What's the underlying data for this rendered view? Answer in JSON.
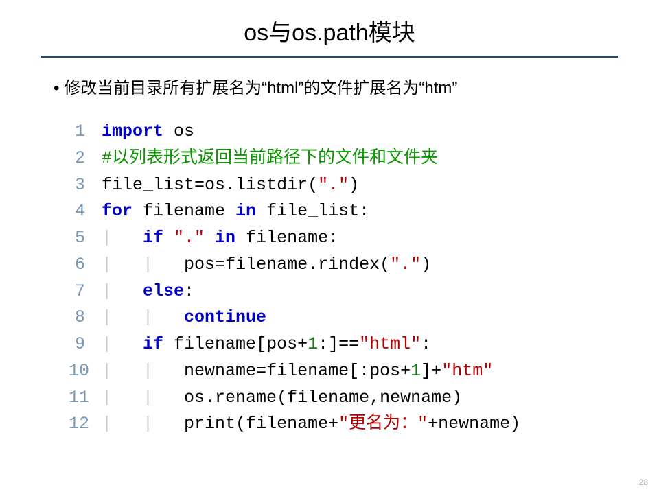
{
  "title": "os与os.path模块",
  "bullet": "修改当前目录所有扩展名为“html”的文件扩展名为“htm”",
  "page_number": "28",
  "code": {
    "lines": [
      {
        "n": "1",
        "tokens": [
          {
            "t": "import ",
            "c": "kw"
          },
          {
            "t": "os",
            "c": "id"
          }
        ]
      },
      {
        "n": "2",
        "tokens": [
          {
            "t": "#以列表形式返回当前路径下的文件和文件夹",
            "c": "cmt"
          }
        ]
      },
      {
        "n": "3",
        "tokens": [
          {
            "t": "file_list",
            "c": "id"
          },
          {
            "t": "=",
            "c": "punct"
          },
          {
            "t": "os.listdir",
            "c": "id"
          },
          {
            "t": "(",
            "c": "punct"
          },
          {
            "t": "\".\"",
            "c": "str"
          },
          {
            "t": ")",
            "c": "punct"
          }
        ]
      },
      {
        "n": "4",
        "tokens": [
          {
            "t": "for ",
            "c": "kw"
          },
          {
            "t": "filename ",
            "c": "id"
          },
          {
            "t": "in ",
            "c": "kw"
          },
          {
            "t": "file_list",
            "c": "id"
          },
          {
            "t": ":",
            "c": "punct"
          }
        ]
      },
      {
        "n": "5",
        "tokens": [
          {
            "t": "|   ",
            "c": "guide"
          },
          {
            "t": "if ",
            "c": "kw"
          },
          {
            "t": "\".\"",
            "c": "str"
          },
          {
            "t": " in ",
            "c": "kw"
          },
          {
            "t": "filename",
            "c": "id"
          },
          {
            "t": ":",
            "c": "punct"
          }
        ]
      },
      {
        "n": "6",
        "tokens": [
          {
            "t": "|   |   ",
            "c": "guide"
          },
          {
            "t": "pos",
            "c": "id"
          },
          {
            "t": "=",
            "c": "punct"
          },
          {
            "t": "filename.rindex",
            "c": "id"
          },
          {
            "t": "(",
            "c": "punct"
          },
          {
            "t": "\".\"",
            "c": "str"
          },
          {
            "t": ")",
            "c": "punct"
          }
        ]
      },
      {
        "n": "7",
        "tokens": [
          {
            "t": "|   ",
            "c": "guide"
          },
          {
            "t": "else",
            "c": "kw"
          },
          {
            "t": ":",
            "c": "punct"
          }
        ]
      },
      {
        "n": "8",
        "tokens": [
          {
            "t": "|   |   ",
            "c": "guide"
          },
          {
            "t": "continue",
            "c": "kw2"
          }
        ]
      },
      {
        "n": "9",
        "tokens": [
          {
            "t": "|   ",
            "c": "guide"
          },
          {
            "t": "if ",
            "c": "kw"
          },
          {
            "t": "filename",
            "c": "id"
          },
          {
            "t": "[",
            "c": "punct"
          },
          {
            "t": "pos",
            "c": "id"
          },
          {
            "t": "+",
            "c": "punct"
          },
          {
            "t": "1",
            "c": "num"
          },
          {
            "t": ":]",
            "c": "punct"
          },
          {
            "t": "==",
            "c": "punct"
          },
          {
            "t": "\"html\"",
            "c": "str"
          },
          {
            "t": ":",
            "c": "punct"
          }
        ]
      },
      {
        "n": "10",
        "tokens": [
          {
            "t": "|   |   ",
            "c": "guide"
          },
          {
            "t": "newname",
            "c": "id"
          },
          {
            "t": "=",
            "c": "punct"
          },
          {
            "t": "filename",
            "c": "id"
          },
          {
            "t": "[:",
            "c": "punct"
          },
          {
            "t": "pos",
            "c": "id"
          },
          {
            "t": "+",
            "c": "punct"
          },
          {
            "t": "1",
            "c": "num"
          },
          {
            "t": "]+",
            "c": "punct"
          },
          {
            "t": "\"htm\"",
            "c": "str"
          }
        ]
      },
      {
        "n": "11",
        "tokens": [
          {
            "t": "|   |   ",
            "c": "guide"
          },
          {
            "t": "os.rename",
            "c": "id"
          },
          {
            "t": "(",
            "c": "punct"
          },
          {
            "t": "filename",
            "c": "id"
          },
          {
            "t": ",",
            "c": "punct"
          },
          {
            "t": "newname",
            "c": "id"
          },
          {
            "t": ")",
            "c": "punct"
          }
        ]
      },
      {
        "n": "12",
        "tokens": [
          {
            "t": "|   |   ",
            "c": "guide"
          },
          {
            "t": "print",
            "c": "id"
          },
          {
            "t": "(",
            "c": "punct"
          },
          {
            "t": "filename",
            "c": "id"
          },
          {
            "t": "+",
            "c": "punct"
          },
          {
            "t": "\"更名为：\"",
            "c": "str"
          },
          {
            "t": "+",
            "c": "punct"
          },
          {
            "t": "newname",
            "c": "id"
          },
          {
            "t": ")",
            "c": "punct"
          }
        ]
      }
    ]
  }
}
